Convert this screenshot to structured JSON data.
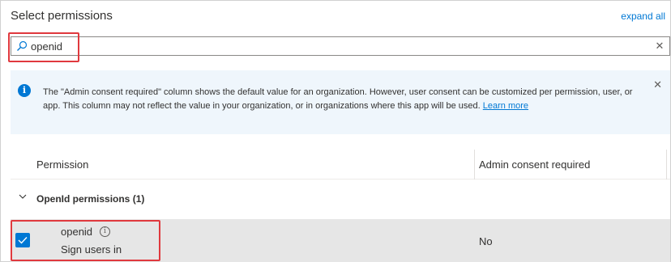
{
  "header": {
    "title": "Select permissions",
    "expand_all": "expand all"
  },
  "search": {
    "value": "openid",
    "icon": "search-icon",
    "clear_icon": "close-icon"
  },
  "info": {
    "text": "The \"Admin consent required\" column shows the default value for an organization. However, user consent can be customized per permission, user, or app. This column may not reflect the value in your organization, or in organizations where this app will be used.",
    "link": "Learn more"
  },
  "table": {
    "columns": [
      "Permission",
      "Admin consent required"
    ],
    "groups": [
      {
        "label": "OpenId permissions (1)",
        "rows": [
          {
            "name": "openid",
            "description": "Sign users in",
            "admin_consent": "No",
            "checked": true
          }
        ]
      }
    ]
  },
  "colors": {
    "accent": "#0078d4",
    "highlight": "#e0393e",
    "info_bg": "#eff6fc",
    "selected_row_bg": "#e6e6e6"
  }
}
